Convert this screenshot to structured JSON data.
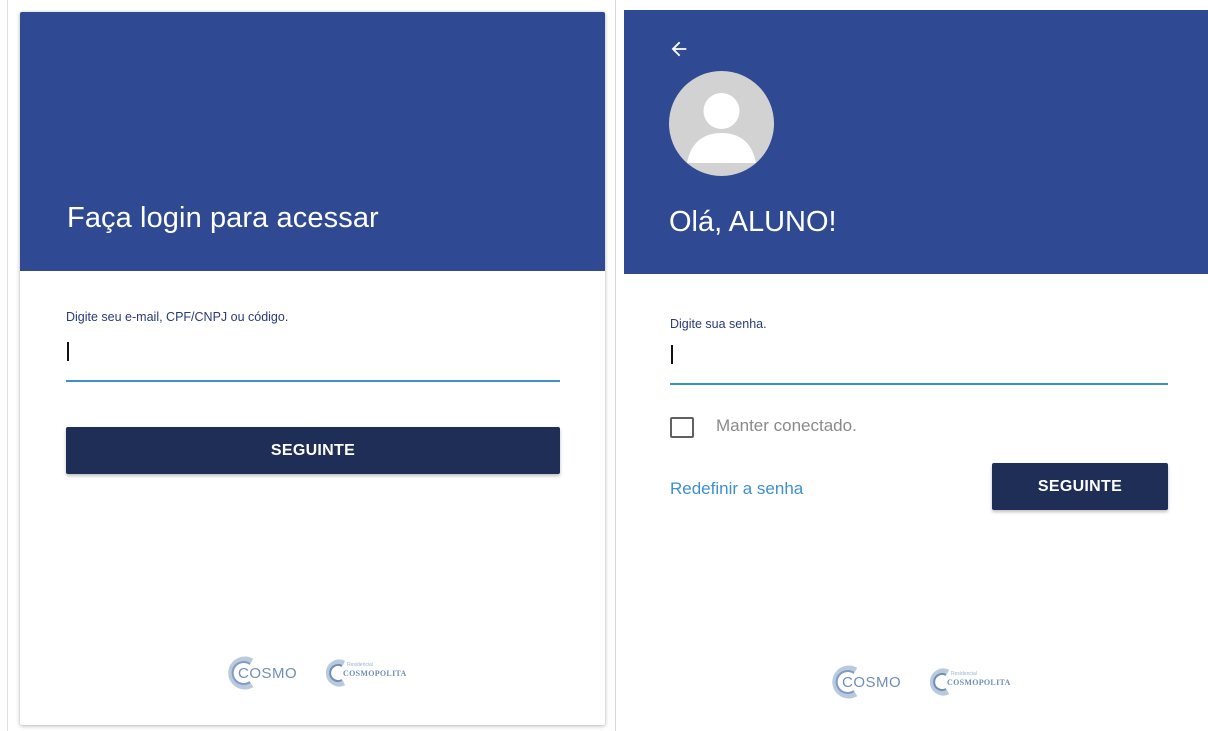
{
  "login_card": {
    "title": "Faça login para acessar",
    "field_label": "Digite seu e-mail, CPF/CNPJ ou código.",
    "input_value": "",
    "button_label": "SEGUINTE"
  },
  "password_card": {
    "greeting": "Olá, ALUNO!",
    "field_label": "Digite sua senha.",
    "input_value": "",
    "keep_connected_label": "Manter conectado.",
    "keep_connected_checked": false,
    "reset_link_label": "Redefinir a senha",
    "button_label": "SEGUINTE"
  },
  "logos": {
    "cosmo": "COSMO",
    "cosmopolita": "COSMOPOLITA",
    "cosmopolita_prefix": "Residencial"
  },
  "colors": {
    "header_blue": "#2f4a93",
    "button_navy": "#1e2e57",
    "input_underline": "#3d8fd1",
    "link_blue": "#3d8fd1"
  },
  "icons": {
    "back": "arrow-left-icon",
    "avatar": "user-avatar-icon"
  }
}
